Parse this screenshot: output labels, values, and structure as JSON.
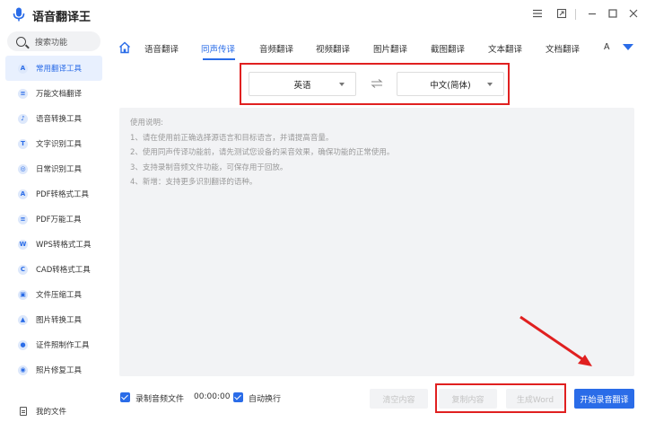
{
  "app": {
    "title": "语音翻译王"
  },
  "window_controls": [
    "menu-icon",
    "restore-icon",
    "minimize-icon",
    "maximize-icon",
    "close-icon"
  ],
  "sidebar": {
    "search_label": "搜索功能",
    "items": [
      {
        "label": "常用翻译工具",
        "icon": "A",
        "active": true
      },
      {
        "label": "万能文档翻译",
        "icon": "≡"
      },
      {
        "label": "语音转换工具",
        "icon": "♪"
      },
      {
        "label": "文字识别工具",
        "icon": "T"
      },
      {
        "label": "日常识别工具",
        "icon": "◎"
      },
      {
        "label": "PDF转格式工具",
        "icon": "A"
      },
      {
        "label": "PDF万能工具",
        "icon": "≡"
      },
      {
        "label": "WPS转格式工具",
        "icon": "W"
      },
      {
        "label": "CAD转格式工具",
        "icon": "C"
      },
      {
        "label": "文件压缩工具",
        "icon": "▣"
      },
      {
        "label": "图片转换工具",
        "icon": "▲"
      },
      {
        "label": "证件照制作工具",
        "icon": "●"
      },
      {
        "label": "照片修复工具",
        "icon": "◉"
      }
    ],
    "my_files": "我的文件"
  },
  "tabs": [
    "语音翻译",
    "同声传译",
    "音频翻译",
    "视频翻译",
    "图片翻译",
    "截图翻译",
    "文本翻译",
    "文档翻译",
    "A"
  ],
  "active_tab": "同声传译",
  "language": {
    "source": "英语",
    "target": "中文(简体)"
  },
  "help": {
    "title": "使用说明:",
    "lines": [
      "1、请在使用前正确选择源语言和目标语言，并请提高音量。",
      "2、使用同声传译功能前，请先测试您设备的采音效果，确保功能的正常使用。",
      "3、支持录制音频文件功能，可保存用于回放。",
      "4、新增：支持更多识别翻译的语种。"
    ]
  },
  "bottom": {
    "record_label": "录制音频文件",
    "timer": "00:00:00",
    "auto_wrap_label": "自动换行",
    "clear_button": "清空内容",
    "copy_button": "复制内容",
    "word_button": "生成Word",
    "start_button": "开始录音翻译"
  },
  "colors": {
    "accent": "#2a6ce8",
    "annotation": "#e02020"
  }
}
